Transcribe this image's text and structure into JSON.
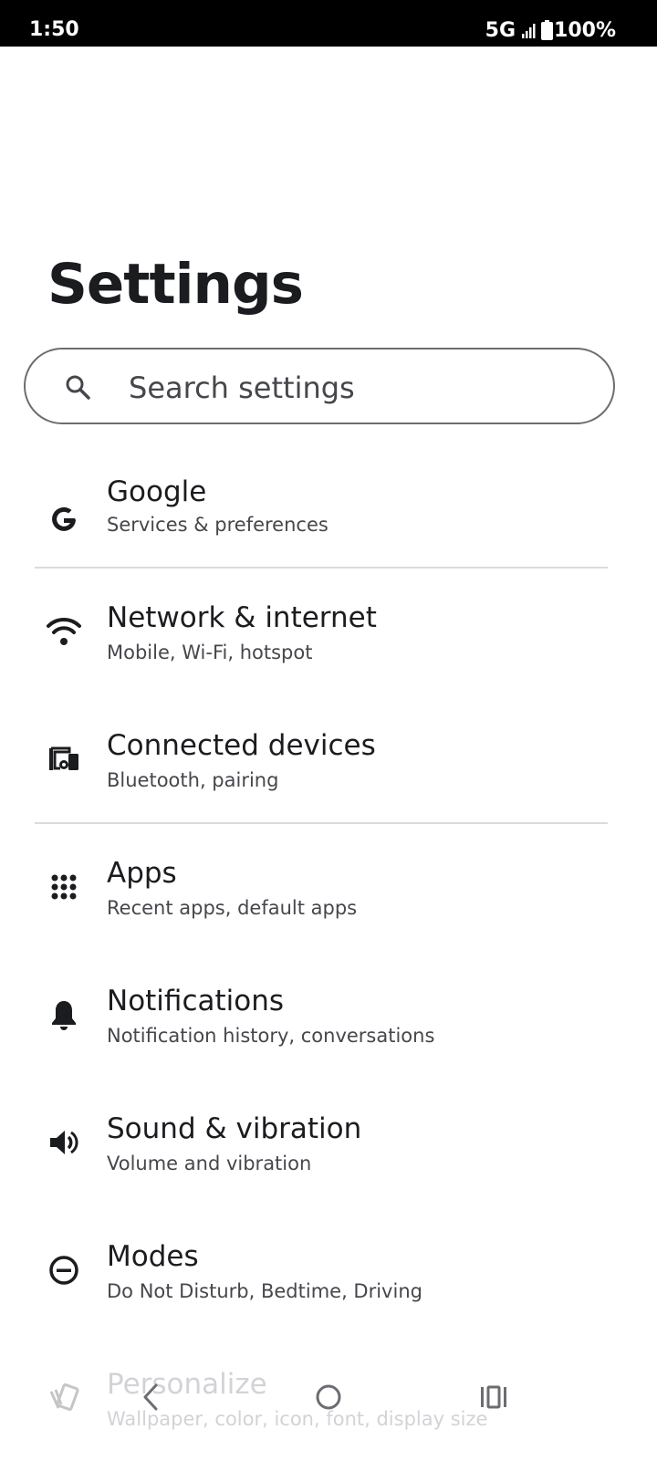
{
  "status_bar": {
    "time": "1:50",
    "network": "5G",
    "battery": "100%"
  },
  "header": {
    "title": "Settings"
  },
  "search": {
    "placeholder": "Search settings"
  },
  "items": [
    {
      "icon": "google-icon",
      "title": "Google",
      "subtitle": "Services & preferences"
    },
    {
      "icon": "wifi-icon",
      "title": "Network & internet",
      "subtitle": "Mobile, Wi-Fi, hotspot"
    },
    {
      "icon": "connected-devices-icon",
      "title": "Connected devices",
      "subtitle": "Bluetooth, pairing"
    },
    {
      "icon": "apps-grid-icon",
      "title": "Apps",
      "subtitle": "Recent apps, default apps"
    },
    {
      "icon": "bell-icon",
      "title": "Notifications",
      "subtitle": "Notification history, conversations"
    },
    {
      "icon": "speaker-icon",
      "title": "Sound & vibration",
      "subtitle": "Volume and vibration"
    },
    {
      "icon": "minus-circle-icon",
      "title": "Modes",
      "subtitle": "Do Not Disturb, Bedtime, Driving"
    },
    {
      "icon": "personalize-icon",
      "title": "Personalize",
      "subtitle": "Wallpaper, color, icon, font, display size"
    }
  ],
  "colors": {
    "text_primary": "#1b1c1f",
    "text_secondary": "#45474c",
    "divider": "#dadbe0",
    "status_bar_bg": "#000000"
  }
}
